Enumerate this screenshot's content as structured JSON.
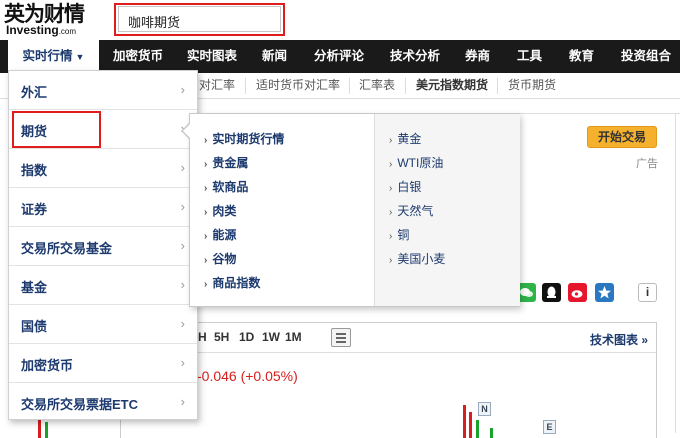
{
  "header": {
    "logo_cn": "英为财情",
    "logo_en": "Investing",
    "logo_en_suffix": ".com",
    "search_value": "咖啡期货"
  },
  "nav": {
    "active": "实时行情",
    "items": [
      "加密货币",
      "实时图表",
      "新闻",
      "分析评论",
      "技术分析",
      "券商",
      "工具",
      "教育",
      "投资组合"
    ]
  },
  "subnav": {
    "items": [
      "对汇率",
      "适时货币对汇率",
      "汇率表",
      "美元指数期货",
      "货币期货"
    ]
  },
  "dropdown": {
    "items": [
      "外汇",
      "期货",
      "指数",
      "证券",
      "交易所交易基金",
      "基金",
      "国债",
      "加密货币",
      "交易所交易票据ETC"
    ]
  },
  "submenu": {
    "left": [
      "实时期货行情",
      "贵金属",
      "软商品",
      "肉类",
      "能源",
      "谷物",
      "商品指数"
    ],
    "right": [
      "黄金",
      "WTI原油",
      "白银",
      "天然气",
      "铜",
      "美国小麦"
    ]
  },
  "background": {
    "start_trading": "开始交易",
    "ad": "广告",
    "timeframes": [
      "H",
      "5H",
      "1D",
      "1W",
      "1M"
    ],
    "tech_chart_link": "技术图表 »",
    "price_change": "-0.046 (+0.05%)",
    "markers": [
      "N",
      "E"
    ]
  },
  "colors": {
    "nav_bg": "#1a1a1a",
    "link_blue": "#1d3a6e",
    "highlight_red": "#e01d1d",
    "cta_orange": "#f5b02e",
    "down_red": "#d91e1e"
  }
}
